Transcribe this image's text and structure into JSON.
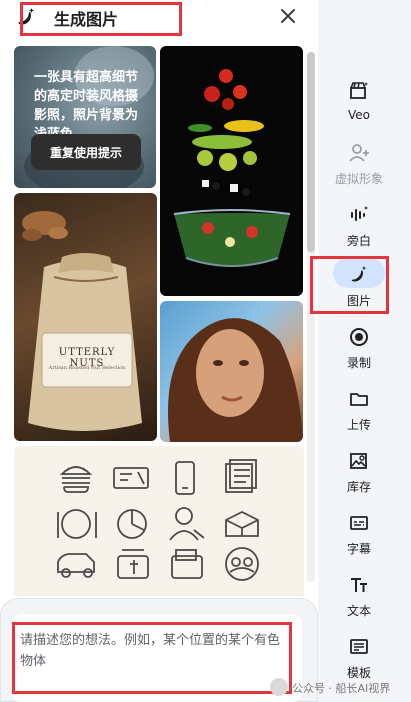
{
  "header": {
    "title": "生成图片",
    "logo_icon": "banana-sparkle-icon",
    "close_icon": "close-icon"
  },
  "gallery": {
    "prompt_preview": "一张具有超高细节的高定时装风格摄影照，照片背景为浅蓝色",
    "reuse_button": "重复使用提示",
    "product_brand": "UTTERLY NUTS",
    "product_sub": "Artisan Roasted Nut Selection"
  },
  "prompt": {
    "placeholder": "请描述您的想法。例如，某个位置的某个有色物体"
  },
  "rail": {
    "items": [
      {
        "label": "Veo",
        "icon": "clapperboard-sparkle-icon"
      },
      {
        "label": "虚拟形象",
        "icon": "avatar-add-icon"
      },
      {
        "label": "旁白",
        "icon": "audio-wave-icon"
      },
      {
        "label": "图片",
        "icon": "banana-sparkle-icon"
      },
      {
        "label": "录制",
        "icon": "record-icon"
      },
      {
        "label": "上传",
        "icon": "folder-icon"
      },
      {
        "label": "库存",
        "icon": "image-library-icon"
      },
      {
        "label": "字幕",
        "icon": "captions-icon"
      },
      {
        "label": "文本",
        "icon": "text-icon"
      },
      {
        "label": "模板",
        "icon": "template-icon"
      }
    ]
  },
  "watermark": "公众号 · 船长AI视界",
  "colors": {
    "highlight": "#e5343c",
    "active_pill": "#d3e3fd",
    "rail_bg": "#f3f5f9"
  }
}
